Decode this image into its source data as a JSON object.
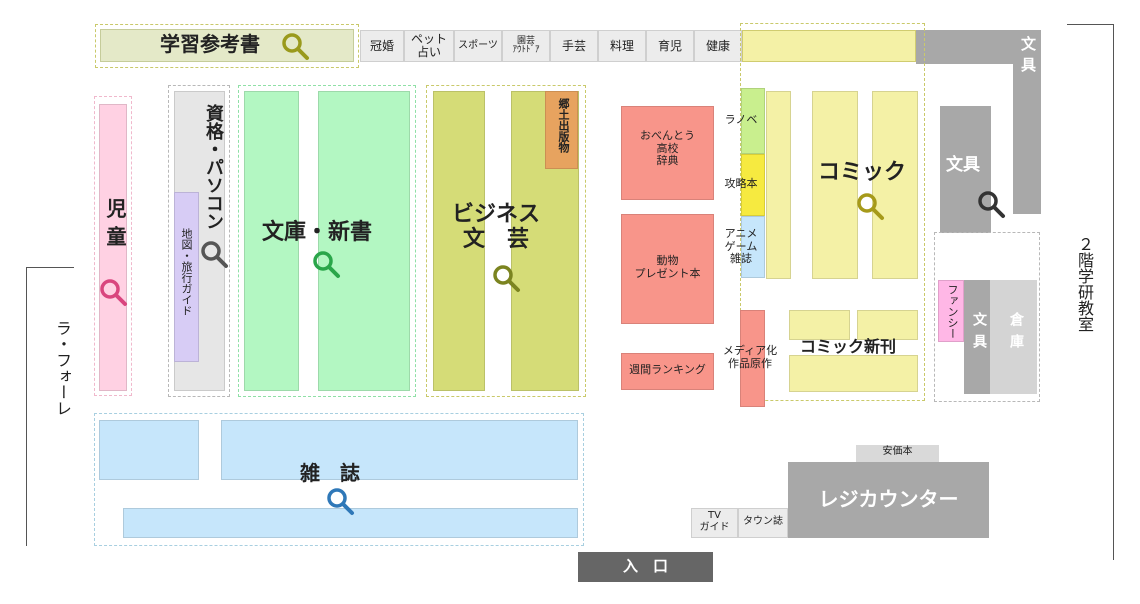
{
  "top_bar": {
    "study": "学習参考書",
    "cells": [
      "冠婚",
      "ペット\n占い",
      "スポーツ",
      "園芸\nｱｳﾄﾄﾞｱ",
      "手芸",
      "料理",
      "育児",
      "健康"
    ]
  },
  "left_side": {
    "label": "ラ・フォーレ"
  },
  "right_side": {
    "label": "２階学研教室"
  },
  "sections": {
    "children": "児童",
    "qualification": "資格・パソコン",
    "map_travel": "地図・旅行ガイド",
    "bunko": "文庫・新書",
    "business": "ビジネス\n文　芸",
    "local": "郷土出版物",
    "obento": "おべんとう\n高校\n辞典",
    "animal": "動物\nプレゼント本",
    "weekly": "週間ランキング",
    "ranobe": "ラノベ",
    "guide": "攻略本",
    "anime": "アニメ\nゲーム\n雑誌",
    "media": "メディア化\n作品原作",
    "comic": "コミック",
    "comic_new": "コミック新刊",
    "stationery_top": "文具",
    "stationery_mid": "文具",
    "stationery_low": "文具",
    "fancy": "ファンシー",
    "storage": "倉庫",
    "magazine": "雑　誌",
    "tv_guide": "TV\nガイド",
    "town": "タウン誌",
    "bargain": "安価本",
    "register": "レジカウンター",
    "entrance": "入　口"
  },
  "colors": {
    "green": "#b3f7c2",
    "pink": "#ffd1e3",
    "olive": "#d5dc77",
    "salmon": "#f8958a",
    "yellow": "#f4f1a6",
    "blue": "#c6e6fb",
    "gray": "#a8a8a8",
    "lavender": "#d7ccf5",
    "sage": "#e4e9c8"
  }
}
